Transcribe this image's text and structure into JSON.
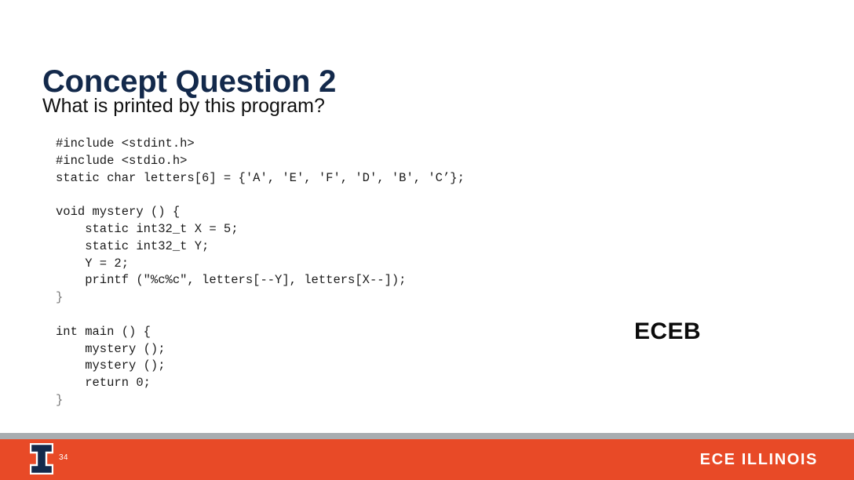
{
  "slide": {
    "title": "Concept Question 2",
    "subtitle": "What is printed by this program?",
    "title_color": "#13294b",
    "background_color": "#ffffff"
  },
  "code": {
    "language": "c",
    "lines": [
      "#include <stdint.h>",
      "#include <stdio.h>",
      "static char letters[6] = {'A', 'E', 'F', 'D', 'B', 'C’};",
      "",
      "void mystery () {",
      "    static int32_t X = 5;",
      "    static int32_t Y;",
      "    Y = 2;",
      "    printf (\"%c%c\", letters[--Y], letters[X--]);",
      "}",
      "",
      "int main () {",
      "    mystery ();",
      "    mystery ();",
      "    return 0;",
      "}"
    ],
    "dim_line_indices": [
      9,
      15
    ]
  },
  "annotation": {
    "answer_text": "ECEB"
  },
  "footer": {
    "rule_color": "#a8adb0",
    "bar_color": "#e84a27",
    "page_number": "34",
    "wordmark": "ECE ILLINOIS",
    "logo_name": "illinois-block-i-logo"
  }
}
